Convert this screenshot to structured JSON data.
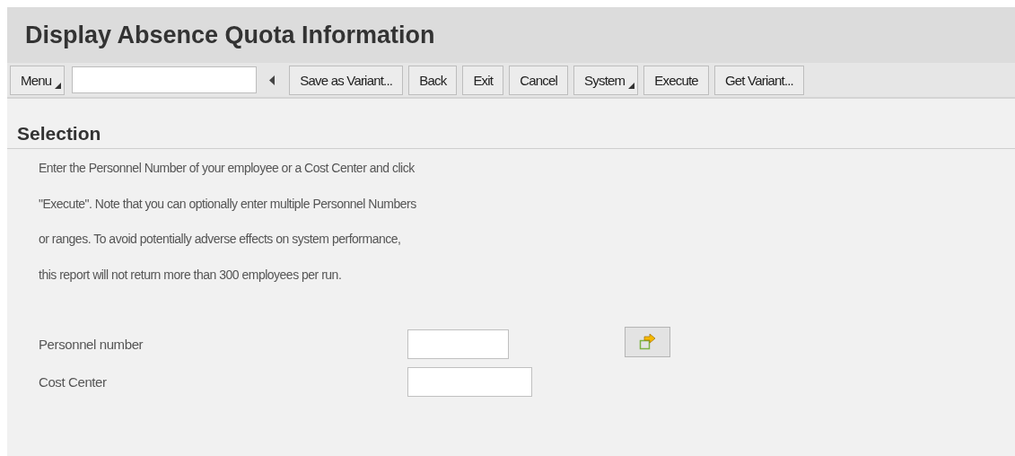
{
  "window": {
    "title": "Display Absence Quota Information"
  },
  "toolbar": {
    "buttons": [
      {
        "label": "Menu",
        "kind": "menu"
      },
      {
        "kind": "command-field"
      },
      {
        "kind": "back-arrow"
      },
      {
        "label": "Save as Variant...",
        "kind": "button"
      },
      {
        "label": "Back",
        "kind": "button"
      },
      {
        "label": "Exit",
        "kind": "button"
      },
      {
        "label": "Cancel",
        "kind": "button"
      },
      {
        "label": "System",
        "kind": "menu"
      },
      {
        "label": "Execute",
        "kind": "button"
      },
      {
        "label": "Get Variant...",
        "kind": "button"
      }
    ]
  },
  "section": {
    "title": "Selection",
    "instructions": [
      "Enter the Personnel Number of your employee or a Cost Center and click",
      "\"Execute\".  Note that you can optionally enter multiple Personnel Numbers",
      "or ranges.  To avoid potentially adverse effects on system performance,",
      "this report will not return more than 300 employees per run."
    ],
    "fields": [
      {
        "label": "Personnel number",
        "kind": "with-button"
      },
      {
        "label": "Cost Center",
        "kind": "plain"
      }
    ]
  }
}
